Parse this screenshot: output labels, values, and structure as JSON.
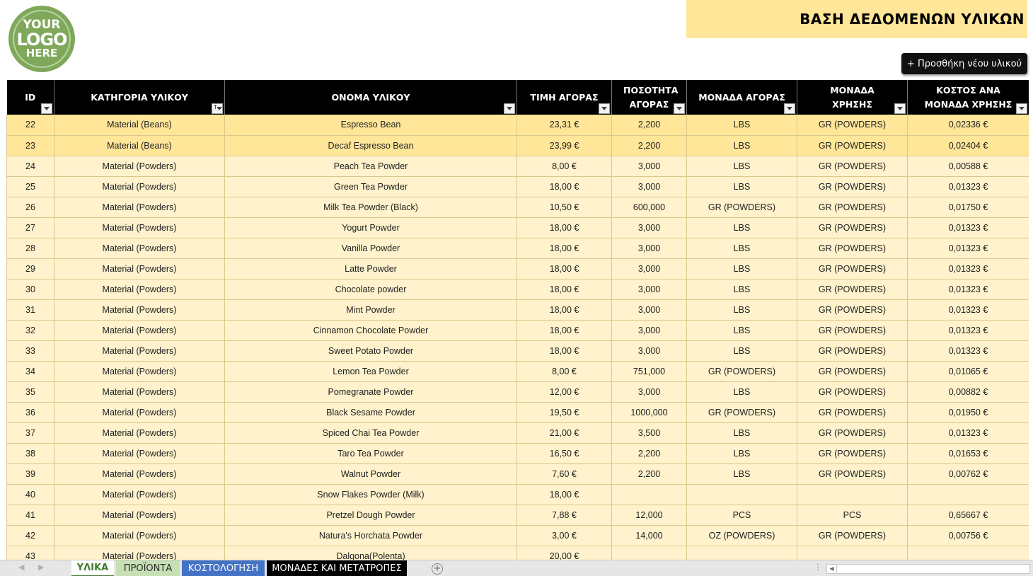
{
  "logo": {
    "line1": "YOUR",
    "line2": "LOGO",
    "line3": "HERE"
  },
  "title": "ΒΑΣΗ ΔΕΔΟΜΕΝΩΝ ΥΛΙΚΩΝ",
  "add_button_label": "+ Προσθήκη νέου υλικού",
  "colors": {
    "header_bg": "#000000",
    "row_bg": "#fff2cc",
    "highlight_row_bg": "#ffe699",
    "title_bg": "#ffe699"
  },
  "columns": [
    {
      "label": "ID",
      "filter": "filter",
      "align": "center"
    },
    {
      "label": "ΚΑΤΗΓΟΡΙΑ ΥΛΙΚΟΥ",
      "filter": "sorted"
    },
    {
      "label": "ΟΝΟΜΑ ΥΛΙΚΟΥ",
      "filter": "filter"
    },
    {
      "label": "ΤΙΜΗ ΑΓΟΡΑΣ",
      "filter": "filter"
    },
    {
      "label": "ΠΟΣΟΤΗΤΑ ΑΓΟΡΑΣ",
      "filter": "filter"
    },
    {
      "label": "ΜΟΝΑΔΑ ΑΓΟΡΑΣ",
      "filter": "filter"
    },
    {
      "label": "ΜΟΝΑΔΑ ΧΡΗΣΗΣ",
      "filter": "filter"
    },
    {
      "label": "ΚΟΣΤΟΣ ΑΝΑ ΜΟΝΑΔΑ ΧΡΗΣΗΣ",
      "filter": "filter"
    }
  ],
  "rows": [
    [
      "22",
      "Material (Beans)",
      "Espresso Bean",
      "23,31 €",
      "2,200",
      "LBS",
      "GR (POWDERS)",
      "0,02336 €"
    ],
    [
      "23",
      "Material (Beans)",
      "Decaf Espresso Bean",
      "23,99 €",
      "2,200",
      "LBS",
      "GR (POWDERS)",
      "0,02404 €"
    ],
    [
      "24",
      "Material (Powders)",
      "Peach Tea Powder",
      "8,00 €",
      "3,000",
      "LBS",
      "GR (POWDERS)",
      "0,00588 €"
    ],
    [
      "25",
      "Material (Powders)",
      "Green Tea Powder",
      "18,00 €",
      "3,000",
      "LBS",
      "GR (POWDERS)",
      "0,01323 €"
    ],
    [
      "26",
      "Material (Powders)",
      "Milk Tea Powder (Black)",
      "10,50 €",
      "600,000",
      "GR (POWDERS)",
      "GR (POWDERS)",
      "0,01750 €"
    ],
    [
      "27",
      "Material (Powders)",
      "Yogurt Powder",
      "18,00 €",
      "3,000",
      "LBS",
      "GR (POWDERS)",
      "0,01323 €"
    ],
    [
      "28",
      "Material (Powders)",
      "Vanilla Powder",
      "18,00 €",
      "3,000",
      "LBS",
      "GR (POWDERS)",
      "0,01323 €"
    ],
    [
      "29",
      "Material (Powders)",
      "Latte Powder",
      "18,00 €",
      "3,000",
      "LBS",
      "GR (POWDERS)",
      "0,01323 €"
    ],
    [
      "30",
      "Material (Powders)",
      "Chocolate powder",
      "18,00 €",
      "3,000",
      "LBS",
      "GR (POWDERS)",
      "0,01323 €"
    ],
    [
      "31",
      "Material (Powders)",
      "Mint Powder",
      "18,00 €",
      "3,000",
      "LBS",
      "GR (POWDERS)",
      "0,01323 €"
    ],
    [
      "32",
      "Material (Powders)",
      "Cinnamon Chocolate Powder",
      "18,00 €",
      "3,000",
      "LBS",
      "GR (POWDERS)",
      "0,01323 €"
    ],
    [
      "33",
      "Material (Powders)",
      "Sweet Potato Powder",
      "18,00 €",
      "3,000",
      "LBS",
      "GR (POWDERS)",
      "0,01323 €"
    ],
    [
      "34",
      "Material (Powders)",
      "Lemon Tea Powder",
      "8,00 €",
      "751,000",
      "GR (POWDERS)",
      "GR (POWDERS)",
      "0,01065 €"
    ],
    [
      "35",
      "Material (Powders)",
      "Pomegranate Powder",
      "12,00 €",
      "3,000",
      "LBS",
      "GR (POWDERS)",
      "0,00882 €"
    ],
    [
      "36",
      "Material (Powders)",
      "Black Sesame Powder",
      "19,50 €",
      "1000,000",
      "GR (POWDERS)",
      "GR (POWDERS)",
      "0,01950 €"
    ],
    [
      "37",
      "Material (Powders)",
      "Spiced Chai Tea Powder",
      "21,00 €",
      "3,500",
      "LBS",
      "GR (POWDERS)",
      "0,01323 €"
    ],
    [
      "38",
      "Material (Powders)",
      "Taro Tea Powder",
      "16,50 €",
      "2,200",
      "LBS",
      "GR (POWDERS)",
      "0,01653 €"
    ],
    [
      "39",
      "Material (Powders)",
      "Walnut Powder",
      "7,60 €",
      "2,200",
      "LBS",
      "GR (POWDERS)",
      "0,00762 €"
    ],
    [
      "40",
      "Material (Powders)",
      "Snow Flakes Powder (Milk)",
      "18,00 €",
      "",
      "",
      "",
      ""
    ],
    [
      "41",
      "Material (Powders)",
      "Pretzel Dough Powder",
      "7,88 €",
      "12,000",
      "PCS",
      "PCS",
      "0,65667 €"
    ],
    [
      "42",
      "Material (Powders)",
      "Natura's Horchata Powder",
      "3,00 €",
      "14,000",
      "OZ (POWDERS)",
      "GR (POWDERS)",
      "0,00756 €"
    ],
    [
      "43",
      "Material (Powders)",
      "Dalgona(Polenta)",
      "20,00 €",
      "",
      "",
      "",
      ""
    ]
  ],
  "highlighted_rows": [
    0,
    1
  ],
  "sheet_tabs": [
    {
      "label": "ΥΛΙΚΑ",
      "style": "active"
    },
    {
      "label": "ΠΡΟΪΟΝΤΑ",
      "style": "green"
    },
    {
      "label": "ΚΟΣΤΟΛΟΓΗΣΗ",
      "style": "blue"
    },
    {
      "label": "ΜΟΝΑΔΕΣ ΚΑΙ ΜΕΤΑΤΡΟΠΕΣ",
      "style": "black"
    }
  ]
}
